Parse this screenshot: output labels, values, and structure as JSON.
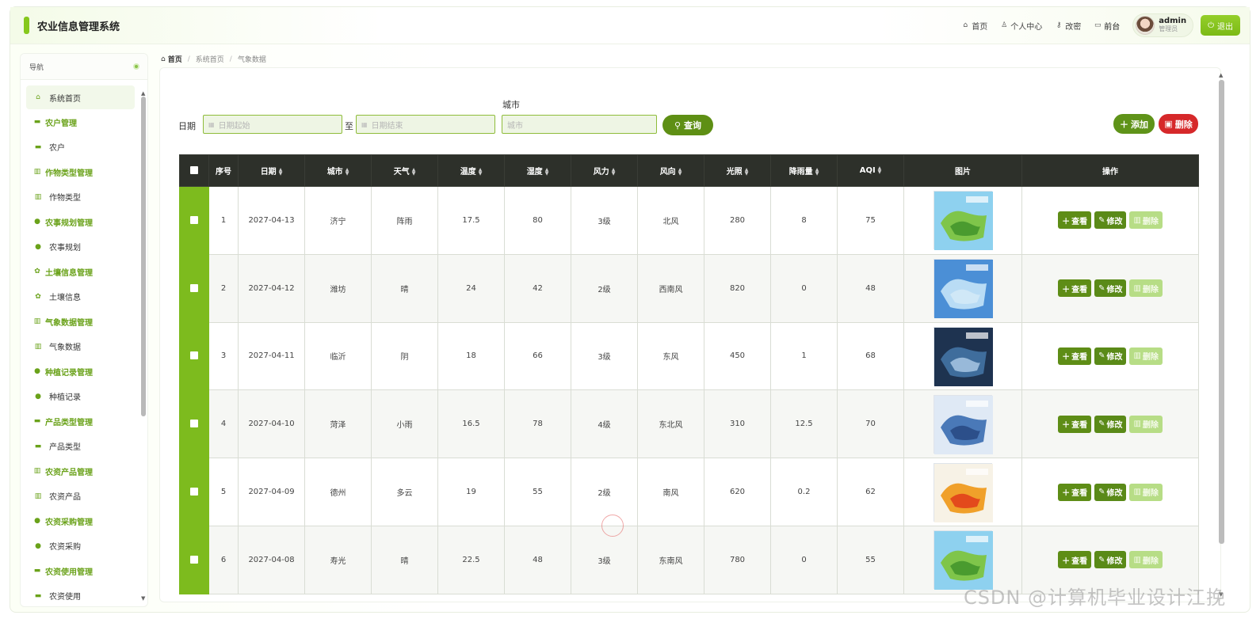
{
  "app": {
    "title": "农业信息管理系统"
  },
  "topnav": {
    "home": "首页",
    "profile": "个人中心",
    "password": "改密",
    "front": "前台",
    "user_name": "admin",
    "user_role": "管理员",
    "logout": "退出"
  },
  "sidebar": {
    "header": "导航",
    "home": "系统首页",
    "groups": [
      {
        "title": "农户管理",
        "icon": "briefcase-icon",
        "item": "农户"
      },
      {
        "title": "作物类型管理",
        "icon": "chart-icon",
        "item": "作物类型"
      },
      {
        "title": "农事规划管理",
        "icon": "pin-icon",
        "item": "农事规划"
      },
      {
        "title": "土壤信息管理",
        "icon": "gear-icon",
        "item": "土壤信息"
      },
      {
        "title": "气象数据管理",
        "icon": "chart-icon",
        "item": "气象数据"
      },
      {
        "title": "种植记录管理",
        "icon": "pin-icon",
        "item": "种植记录"
      },
      {
        "title": "产品类型管理",
        "icon": "briefcase-icon",
        "item": "产品类型"
      },
      {
        "title": "农资产品管理",
        "icon": "chart-icon",
        "item": "农资产品"
      },
      {
        "title": "农资采购管理",
        "icon": "pin-icon",
        "item": "农资采购"
      },
      {
        "title": "农资使用管理",
        "icon": "briefcase-icon",
        "item": "农资使用"
      }
    ]
  },
  "breadcrumb": {
    "home": "首页",
    "level1": "系统首页",
    "level2": "气象数据"
  },
  "search": {
    "date_label": "日期",
    "date_start_placeholder": "日期起始",
    "to": "至",
    "date_end_placeholder": "日期结束",
    "city_label": "城市",
    "city_placeholder": "城市",
    "query": "查询"
  },
  "toolbar": {
    "add": "添加",
    "delete": "删除"
  },
  "table": {
    "columns": [
      "序号",
      "日期",
      "城市",
      "天气",
      "温度",
      "湿度",
      "风力",
      "风向",
      "光照",
      "降雨量",
      "AQI",
      "图片",
      "操作"
    ],
    "rows": [
      {
        "no": "1",
        "date": "2027-04-13",
        "city": "济宁",
        "weather": "阵雨",
        "temp": "17.5",
        "humidity": "80",
        "wind": "3级",
        "dir": "北风",
        "light": "280",
        "rain": "8",
        "aqi": "75",
        "img": "green-map"
      },
      {
        "no": "2",
        "date": "2027-04-12",
        "city": "潍坊",
        "weather": "晴",
        "temp": "24",
        "humidity": "42",
        "wind": "2级",
        "dir": "西南风",
        "light": "820",
        "rain": "0",
        "aqi": "48",
        "img": "blue-forecast"
      },
      {
        "no": "3",
        "date": "2027-04-11",
        "city": "临沂",
        "weather": "阴",
        "temp": "18",
        "humidity": "66",
        "wind": "3级",
        "dir": "东风",
        "light": "450",
        "rain": "1",
        "aqi": "68",
        "img": "dark-forecast"
      },
      {
        "no": "4",
        "date": "2027-04-10",
        "city": "菏泽",
        "weather": "小雨",
        "temp": "16.5",
        "humidity": "78",
        "wind": "4级",
        "dir": "东北风",
        "light": "310",
        "rain": "12.5",
        "aqi": "70",
        "img": "rain-map"
      },
      {
        "no": "5",
        "date": "2027-04-09",
        "city": "德州",
        "weather": "多云",
        "temp": "19",
        "humidity": "55",
        "wind": "2级",
        "dir": "南风",
        "light": "620",
        "rain": "0.2",
        "aqi": "62",
        "img": "orange-map"
      },
      {
        "no": "6",
        "date": "2027-04-08",
        "city": "寿光",
        "weather": "晴",
        "temp": "22.5",
        "humidity": "48",
        "wind": "3级",
        "dir": "东南风",
        "light": "780",
        "rain": "0",
        "aqi": "55",
        "img": "green-map"
      }
    ],
    "actions": {
      "view": "查看",
      "edit": "修改",
      "delete": "删除"
    }
  },
  "watermark": "CSDN @计算机毕业设计江挽"
}
